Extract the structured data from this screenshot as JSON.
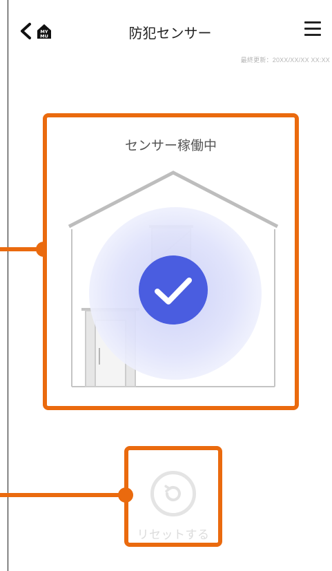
{
  "header": {
    "title": "防犯センサー",
    "logo_text": "MY MU",
    "last_updated": "最終更新：20XX/XX/XX XX:XX"
  },
  "status_card": {
    "title": "センサー稼働中",
    "status_icon": "check-icon",
    "accent_color": "#4a5de0"
  },
  "reset": {
    "label": "リセットする",
    "icon": "reset-icon",
    "enabled": false
  },
  "colors": {
    "highlight": "#ea6a0e",
    "check_badge": "#4a5de0",
    "glow": "#dfe2fb"
  }
}
